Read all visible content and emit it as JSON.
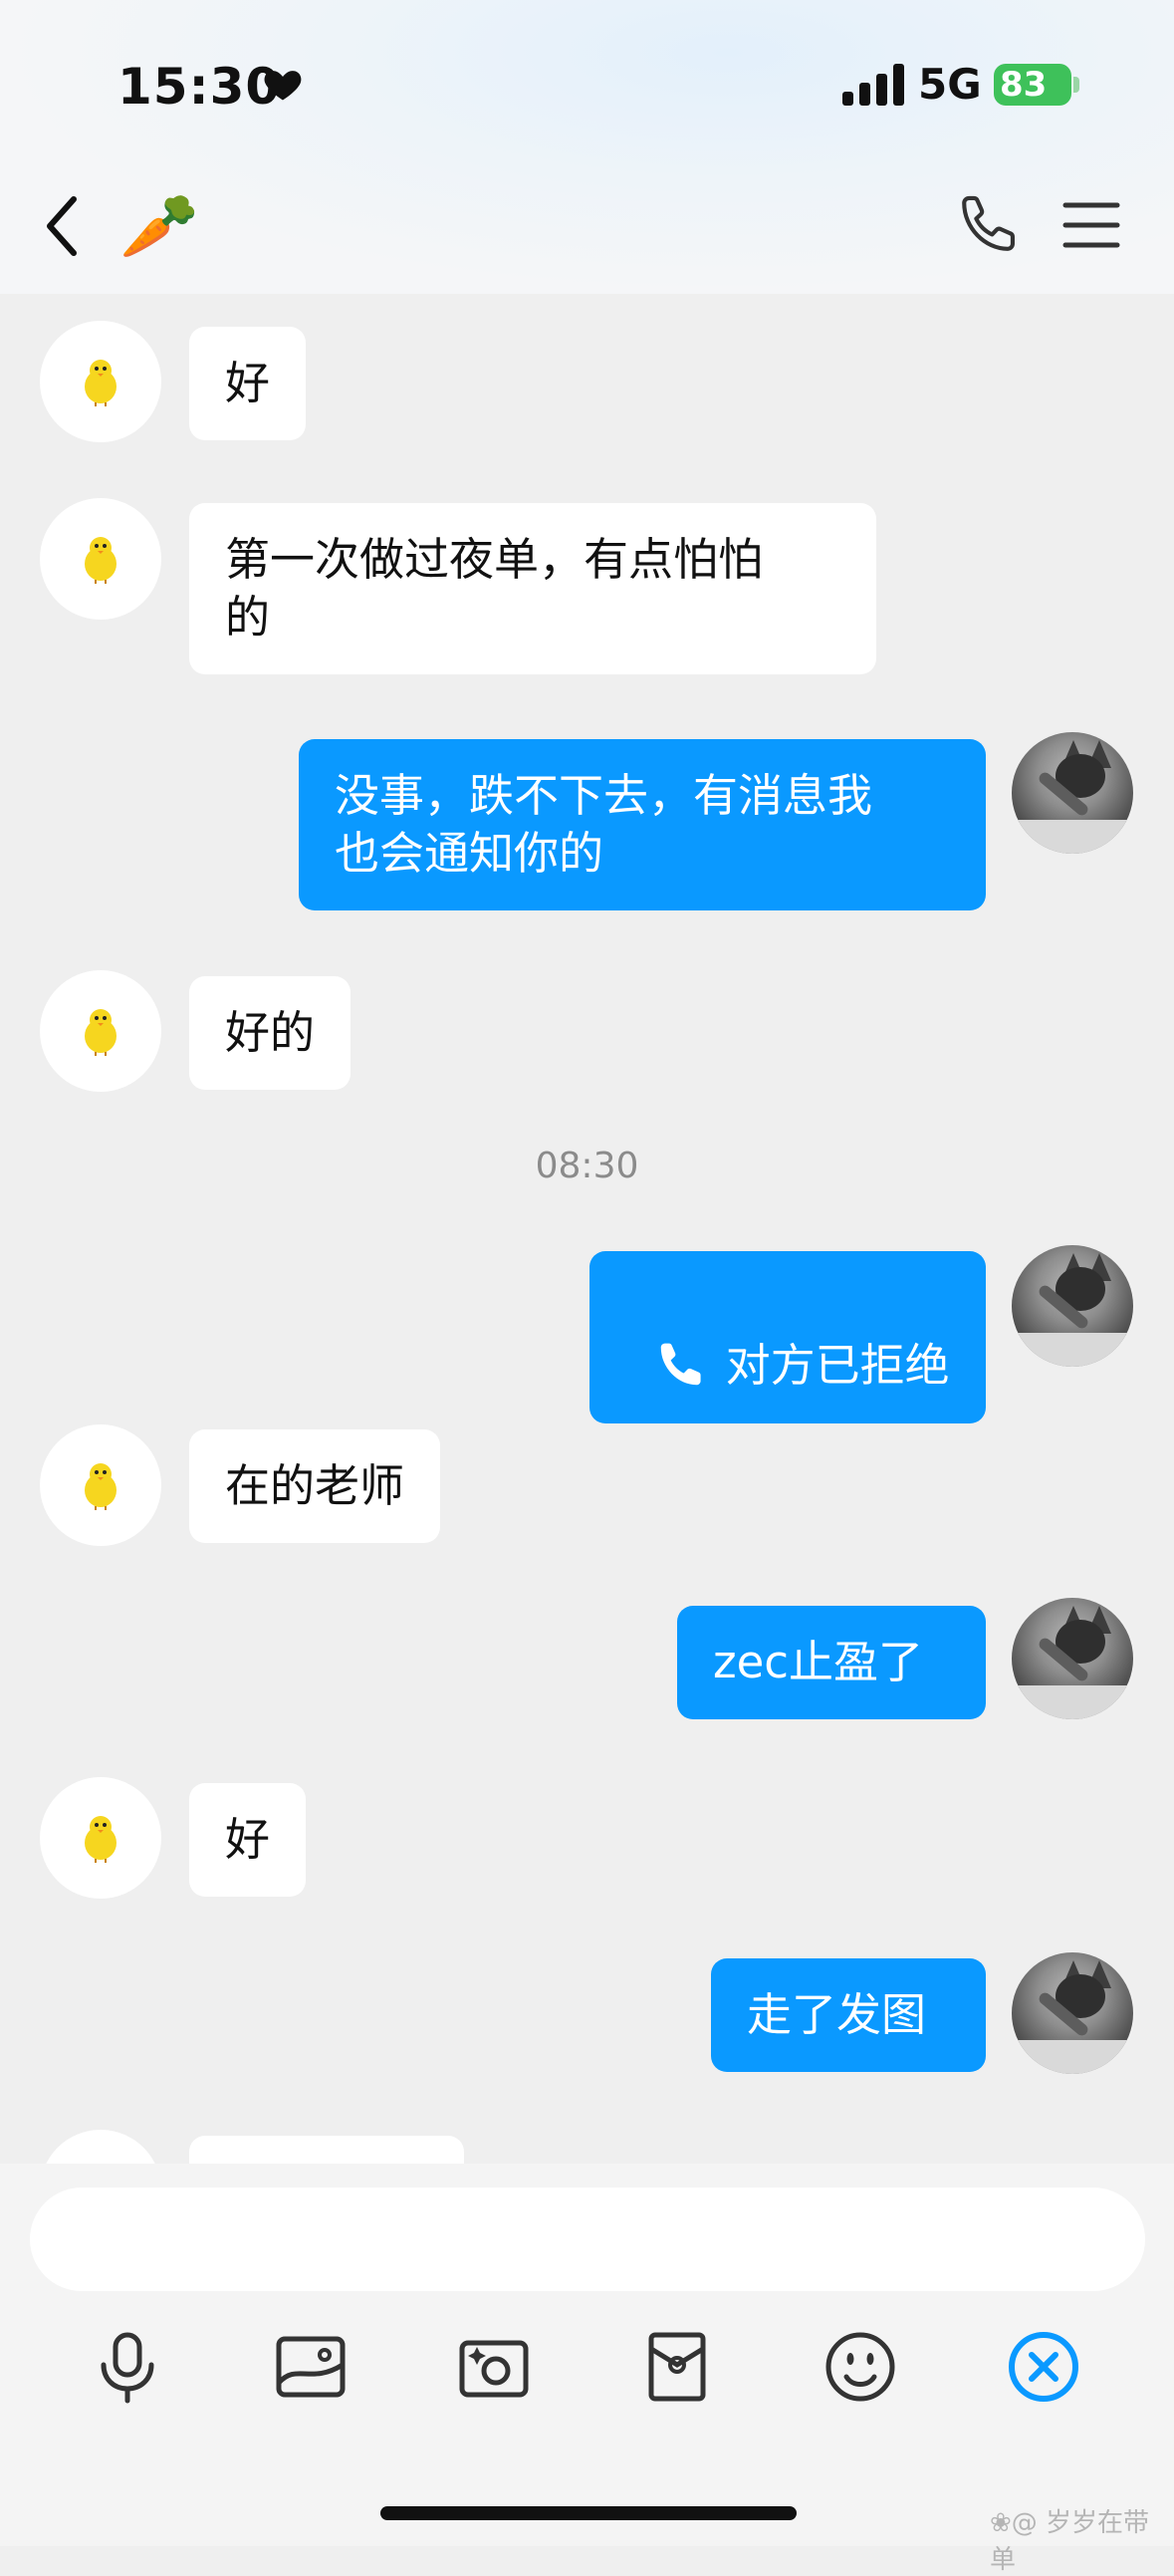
{
  "status_bar": {
    "time": "15:30",
    "network": "5G",
    "battery": "83"
  },
  "nav": {
    "title_emoji": "🥕",
    "back_icon": "chevron-left-icon",
    "call_icon": "phone-icon",
    "menu_icon": "hamburger-menu-icon"
  },
  "messages": [
    {
      "side": "in",
      "text": "好"
    },
    {
      "side": "in",
      "text": "第一次做过夜单，有点怕怕\n的"
    },
    {
      "side": "out",
      "text": "没事，跌不下去，有消息我\n也会通知你的"
    },
    {
      "side": "in",
      "text": "好的"
    },
    {
      "side": "out",
      "text": "对方已拒绝",
      "icon": "phone-icon"
    },
    {
      "side": "in",
      "text": "在的老师"
    },
    {
      "side": "out",
      "text": "zec止盈了"
    },
    {
      "side": "in",
      "text": "好"
    },
    {
      "side": "out",
      "text": "走了发图"
    }
  ],
  "time_separator": "08:30",
  "input": {
    "placeholder": ""
  },
  "toolbar": [
    "microphone-icon",
    "image-icon",
    "camera-icon",
    "red-packet-icon",
    "emoji-icon",
    "close-icon"
  ],
  "watermark": "❀@ 岁岁在带单",
  "colors": {
    "outgoing_bubble": "#0a99ff",
    "incoming_bubble": "#ffffff",
    "background": "#efefef",
    "battery": "#3ec15a"
  }
}
